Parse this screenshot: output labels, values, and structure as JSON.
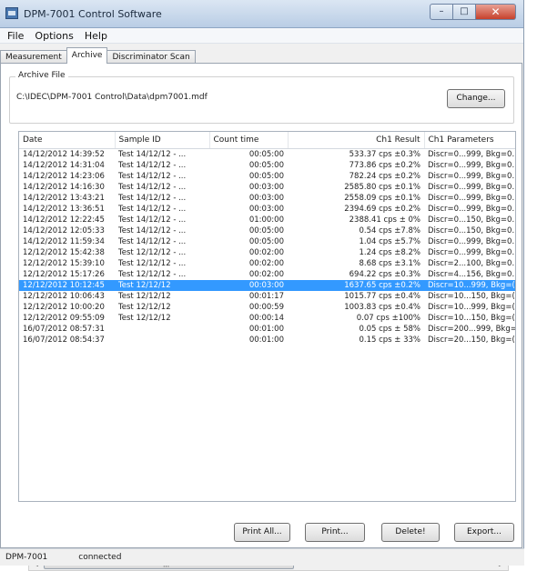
{
  "window": {
    "title": "DPM-7001 Control Software",
    "buttons": {
      "minimize": "–",
      "maximize": "□",
      "close": "✕"
    }
  },
  "menu": [
    "File",
    "Options",
    "Help"
  ],
  "tabs": [
    "Measurement",
    "Archive",
    "Discriminator Scan"
  ],
  "active_tab": "Archive",
  "archive": {
    "group_label": "Archive File",
    "path": "C:\\IDEC\\DPM-7001 Control\\Data\\dpm7001.mdf",
    "change_label": "Change..."
  },
  "table": {
    "columns": [
      "Date",
      "Sample ID",
      "Count time",
      "Ch1 Result",
      "Ch1 Parameters"
    ],
    "rows": [
      [
        "14/12/2012 14:39:52",
        "Test 14/12/12 - ...",
        "00:05:00",
        "533.37 cps ±0.3%",
        "Discr=0...999, Bkg=0."
      ],
      [
        "14/12/2012 14:31:04",
        "Test 14/12/12 - ...",
        "00:05:00",
        "773.86 cps ±0.2%",
        "Discr=0...999, Bkg=0."
      ],
      [
        "14/12/2012 14:23:06",
        "Test 14/12/12 - ...",
        "00:05:00",
        "782.24 cps ±0.2%",
        "Discr=0...999, Bkg=0."
      ],
      [
        "14/12/2012 14:16:30",
        "Test 14/12/12 - ...",
        "00:03:00",
        "2585.80 cps ±0.1%",
        "Discr=0...999, Bkg=0."
      ],
      [
        "14/12/2012 13:43:21",
        "Test 14/12/12 - ...",
        "00:03:00",
        "2558.09 cps ±0.1%",
        "Discr=0...999, Bkg=0."
      ],
      [
        "14/12/2012 13:36:51",
        "Test 14/12/12 - ...",
        "00:03:00",
        "2394.69 cps ±0.2%",
        "Discr=0...999, Bkg=0."
      ],
      [
        "14/12/2012 12:22:45",
        "Test 14/12/12 - ...",
        "01:00:00",
        "2388.41 cps ± 0%",
        "Discr=0...150, Bkg=0."
      ],
      [
        "14/12/2012 12:05:33",
        "Test 14/12/12 - ...",
        "00:05:00",
        "0.54 cps ±7.8%",
        "Discr=0...150, Bkg=0."
      ],
      [
        "14/12/2012 11:59:34",
        "Test 14/12/12 - ...",
        "00:05:00",
        "1.04 cps ±5.7%",
        "Discr=0...999, Bkg=0."
      ],
      [
        "12/12/2012 15:42:38",
        "Test 12/12/12 - ...",
        "00:02:00",
        "1.24 cps ±8.2%",
        "Discr=0...999, Bkg=0."
      ],
      [
        "12/12/2012 15:39:10",
        "Test 12/12/12 - ...",
        "00:02:00",
        "8.68 cps ±3.1%",
        "Discr=2...100, Bkg=0."
      ],
      [
        "12/12/2012 15:17:26",
        "Test 12/12/12 - ...",
        "00:02:00",
        "694.22 cps ±0.3%",
        "Discr=4...156, Bkg=0."
      ],
      [
        "12/12/2012 10:12:45",
        "Test 12/12/12",
        "00:03:00",
        "1637.65 cps ±0.2%",
        "Discr=10...999, Bkg=("
      ],
      [
        "12/12/2012 10:06:43",
        "Test 12/12/12",
        "00:01:17",
        "1015.77 cps ±0.4%",
        "Discr=10...150, Bkg=("
      ],
      [
        "12/12/2012 10:00:20",
        "Test 12/12/12",
        "00:00:59",
        "1003.83 cps ±0.4%",
        "Discr=10...999, Bkg=("
      ],
      [
        "12/12/2012 09:55:09",
        "Test 12/12/12",
        "00:00:14",
        "0.07 cps ±100%",
        "Discr=10...150, Bkg=("
      ],
      [
        "16/07/2012 08:57:31",
        "",
        "00:01:00",
        "0.05 cps ± 58%",
        "Discr=200...999, Bkg="
      ],
      [
        "16/07/2012 08:54:37",
        "",
        "00:01:00",
        "0.15 cps ± 33%",
        "Discr=20...150, Bkg=("
      ]
    ],
    "selected_row": 12
  },
  "buttons": {
    "print_all": "Print All...",
    "print": "Print...",
    "delete": "Delete!",
    "export": "Export..."
  },
  "scrollbar": {
    "left_arrow": "◄",
    "right_arrow": "►",
    "grip": "|||"
  },
  "status": {
    "device": "DPM-7001",
    "state": "connected"
  }
}
